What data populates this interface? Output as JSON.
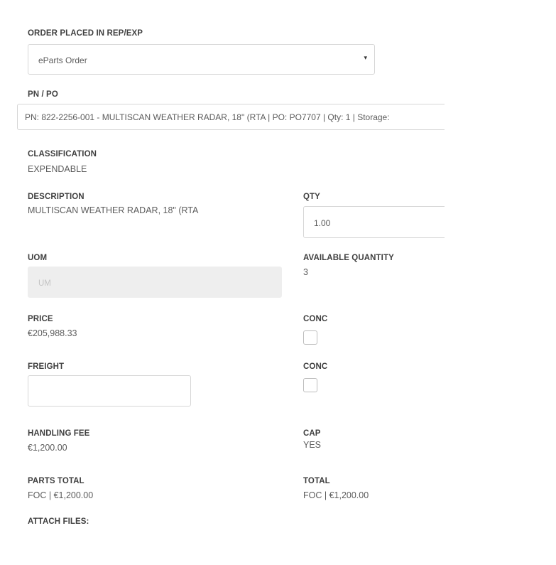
{
  "order_placed": {
    "label": "ORDER PLACED IN REP/EXP",
    "selected": "eParts Order",
    "arrow": "▾"
  },
  "pn_po": {
    "label": "PN / PO",
    "value": "PN: 822-2256-001 - MULTISCAN WEATHER RADAR, 18\" (RTA | PO: PO7707 | Qty: 1 | Storage:"
  },
  "classification": {
    "label": "CLASSIFICATION",
    "value": "EXPENDABLE"
  },
  "description": {
    "label": "DESCRIPTION",
    "value": "MULTISCAN WEATHER RADAR, 18\" (RTA"
  },
  "qty": {
    "label": "QTY",
    "value": "1.00"
  },
  "uom": {
    "label": "UOM",
    "placeholder": "UM"
  },
  "available_quantity": {
    "label": "AVAILABLE QUANTITY",
    "value": "3"
  },
  "price": {
    "label": "PRICE",
    "value": "€205,988.33"
  },
  "conc_price": {
    "label": "CONC",
    "checked": false
  },
  "freight": {
    "label": "FREIGHT",
    "value": ""
  },
  "conc_freight": {
    "label": "CONC",
    "checked": false
  },
  "handling_fee": {
    "label": "HANDLING FEE",
    "value": "€1,200.00"
  },
  "cap": {
    "label": "CAP",
    "value": "YES"
  },
  "parts_total": {
    "label": "PARTS TOTAL",
    "value": "FOC | €1,200.00"
  },
  "total": {
    "label": "TOTAL",
    "value": "FOC | €1,200.00"
  },
  "attach_files": {
    "label": "ATTACH FILES:"
  }
}
